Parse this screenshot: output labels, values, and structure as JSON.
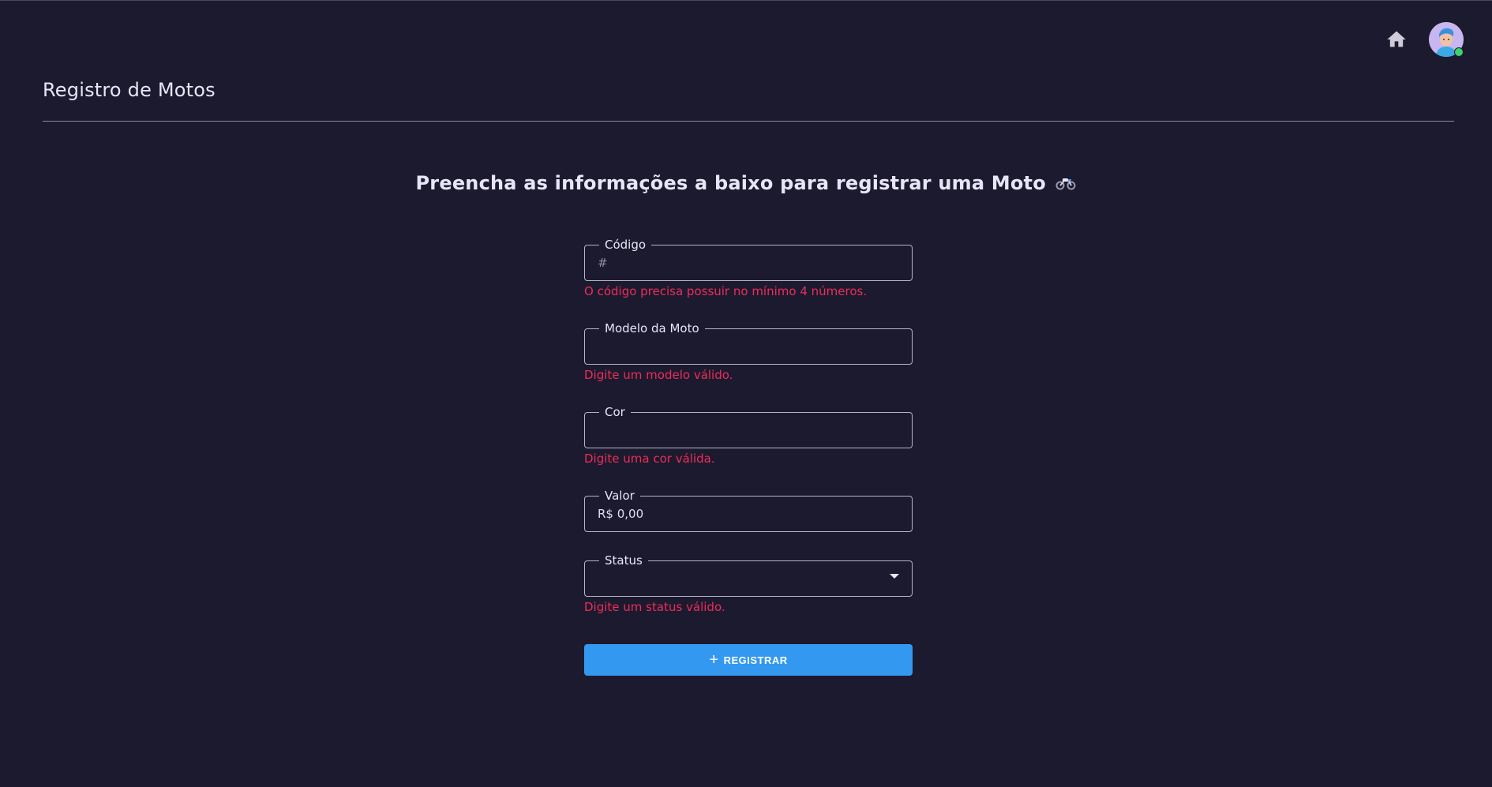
{
  "header": {
    "home_icon": "home-icon",
    "avatar_icon": "user-avatar",
    "online_color": "#3bd36b"
  },
  "page": {
    "title": "Registro de Motos",
    "heading": "Preencha as informações a baixo para registrar uma Moto",
    "heading_icon": "motorcycle-icon"
  },
  "form": {
    "codigo": {
      "label": "Código",
      "placeholder": "#",
      "value": "",
      "error": "O código precisa possuir no mínimo 4 números."
    },
    "modelo": {
      "label": "Modelo da Moto",
      "value": "",
      "error": "Digite um modelo válido."
    },
    "cor": {
      "label": "Cor",
      "value": "",
      "error": "Digite uma cor válida."
    },
    "valor": {
      "label": "Valor",
      "value": "R$ 0,00"
    },
    "status": {
      "label": "Status",
      "value": "",
      "error": "Digite um status válido."
    },
    "submit_label": "REGISTRAR",
    "submit_icon": "plus-icon"
  },
  "colors": {
    "background": "#1c1a2e",
    "error": "#ec2d5a",
    "primary": "#3399f0"
  }
}
